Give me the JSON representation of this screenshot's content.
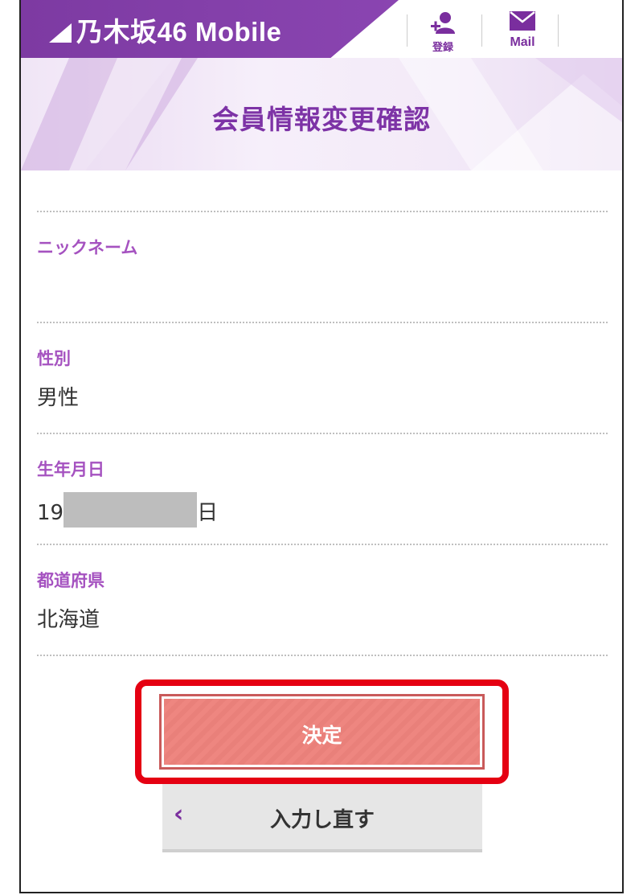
{
  "header": {
    "brand_name": "乃木坂46 Mobile",
    "register_label": "登録",
    "mail_label": "Mail",
    "accent_color": "#7d3aa2"
  },
  "page": {
    "title": "会員情報変更確認"
  },
  "fields": [
    {
      "label": "ニックネーム",
      "value": ""
    },
    {
      "label": "性別",
      "value": "男性"
    },
    {
      "label": "生年月日",
      "value_prefix": "19",
      "value_suffix": "日"
    },
    {
      "label": "都道府県",
      "value": "北海道"
    }
  ],
  "buttons": {
    "confirm_label": "決定",
    "back_label": "入力し直す",
    "back_icon": "chevron-left-icon"
  }
}
